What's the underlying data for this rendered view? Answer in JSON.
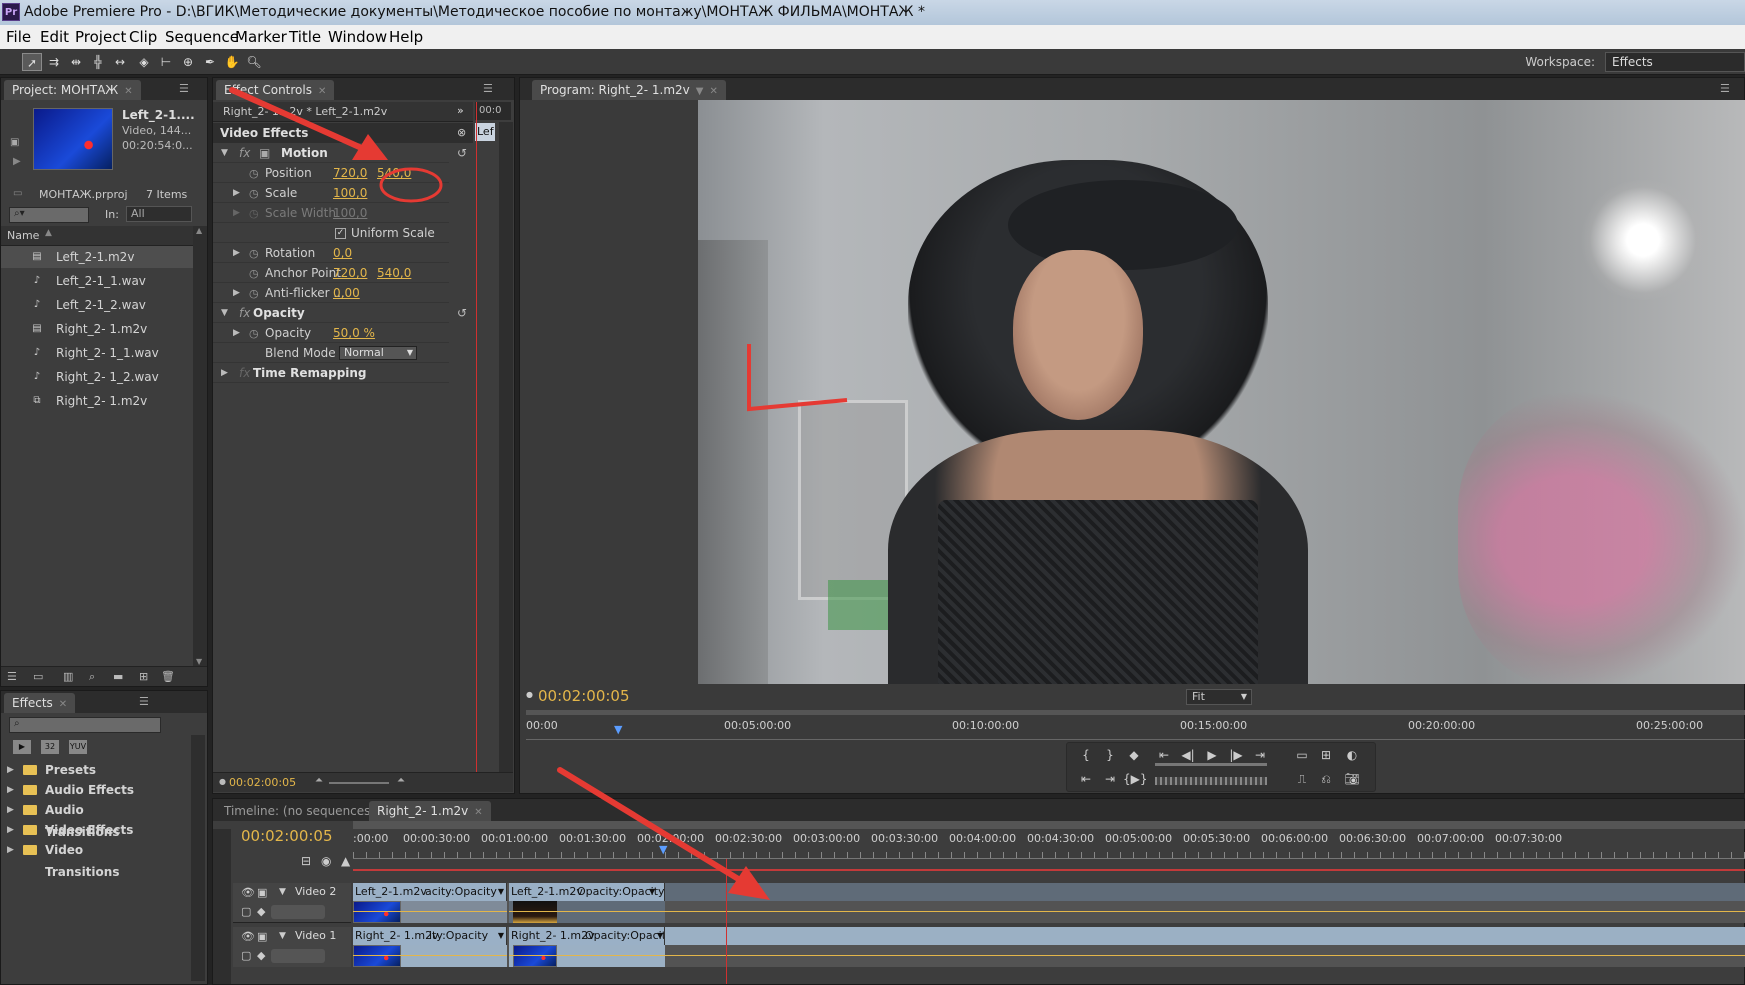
{
  "app": {
    "title": "Adobe Premiere Pro - D:\\ВГИК\\Методические документы\\Методическое пособие по монтажу\\МОНТАЖ ФИЛЬМА\\МОНТАЖ *",
    "logo": "Pr"
  },
  "menu": [
    "File",
    "Edit",
    "Project",
    "Clip",
    "Sequence",
    "Marker",
    "Title",
    "Window",
    "Help"
  ],
  "toolbar": {
    "tools": [
      "selection-tool",
      "track-select-tool",
      "ripple-edit-tool",
      "rolling-edit-tool",
      "rate-stretch-tool",
      "razor-tool",
      "slip-tool",
      "slide-tool",
      "pen-tool",
      "hand-tool",
      "zoom-tool"
    ],
    "workspace_label": "Workspace:",
    "workspace_value": "Effects"
  },
  "project": {
    "tab": "Project: МОНТАЖ",
    "clip_name": "Left_2-1....",
    "clip_info1": "Video, 144...",
    "clip_info2": "00:20:54:0...",
    "project_file": "МОНТАЖ.prproj",
    "item_count": "7 Items",
    "in_label": "In:",
    "in_value": "All",
    "name_header": "Name",
    "items": [
      {
        "name": "Left_2-1.m2v",
        "icon": "video-file-icon"
      },
      {
        "name": "Left_2-1_1.wav",
        "icon": "audio-file-icon"
      },
      {
        "name": "Left_2-1_2.wav",
        "icon": "audio-file-icon"
      },
      {
        "name": "Right_2- 1.m2v",
        "icon": "video-file-icon"
      },
      {
        "name": "Right_2- 1_1.wav",
        "icon": "audio-file-icon"
      },
      {
        "name": "Right_2- 1_2.wav",
        "icon": "audio-file-icon"
      },
      {
        "name": "Right_2- 1.m2v",
        "icon": "sequence-icon"
      }
    ]
  },
  "effects": {
    "tab": "Effects",
    "folders": [
      "Presets",
      "Audio Effects",
      "Audio Transitions",
      "Video Effects",
      "Video Transitions"
    ]
  },
  "effect_controls": {
    "tab": "Effect Controls",
    "header": "Right_2- 1...2v * Left_2-1.m2v",
    "mini_clip": "Lef",
    "mini_time": "00:0",
    "section": "Video Effects",
    "motion": "Motion",
    "position_label": "Position",
    "position_x": "720,0",
    "position_y": "540,0",
    "scale_label": "Scale",
    "scale_value": "100,0",
    "scale_width_label": "Scale Width",
    "scale_width_value": "100,0",
    "uniform_scale": "Uniform Scale",
    "rotation_label": "Rotation",
    "rotation_value": "0,0",
    "anchor_label": "Anchor Point",
    "anchor_x": "720,0",
    "anchor_y": "540,0",
    "antiflicker_label": "Anti-flicker ...",
    "antiflicker_value": "0,00",
    "opacity_section": "Opacity",
    "opacity_label": "Opacity",
    "opacity_value": "50,0 %",
    "blend_label": "Blend Mode",
    "blend_value": "Normal",
    "time_remapping": "Time Remapping",
    "timecode": "00:02:00:05"
  },
  "program": {
    "tab": "Program: Right_2- 1.m2v",
    "timecode": "00:02:00:05",
    "fit": "Fit",
    "ruler": [
      "00:00",
      "00:05:00:00",
      "00:10:00:00",
      "00:15:00:00",
      "00:20:00:00",
      "00:25:00:00"
    ]
  },
  "timeline": {
    "tab_inactive": "Timeline: (no sequences)",
    "tab_active": "Right_2- 1.m2v",
    "timecode": "00:02:00:05",
    "ruler": [
      ":00:00",
      "00:00:30:00",
      "00:01:00:00",
      "00:01:30:00",
      "00:02:00:00",
      "00:02:30:00",
      "00:03:00:00",
      "00:03:30:00",
      "00:04:00:00",
      "00:04:30:00",
      "00:05:00:00",
      "00:05:30:00",
      "00:06:00:00",
      "00:06:30:00",
      "00:07:00:00",
      "00:07:30:00"
    ],
    "tracks": [
      {
        "name": "Video 2",
        "clips": [
          {
            "label": "Left_2-1.m2v",
            "fx": "acity:Opacity"
          },
          {
            "label": "Left_2-1.m2v",
            "fx": "Opacity:Opacity"
          }
        ]
      },
      {
        "name": "Video 1",
        "clips": [
          {
            "label": "Right_2- 1.m2v",
            "fx": "ity:Opacity"
          },
          {
            "label": "Right_2- 1.m2v",
            "fx": "Opacity:Opacity"
          }
        ]
      }
    ]
  },
  "colors": {
    "accent_timecode": "#e3b64a",
    "annotation_red": "#e53a33",
    "panel_bg": "#3d3d3d"
  }
}
